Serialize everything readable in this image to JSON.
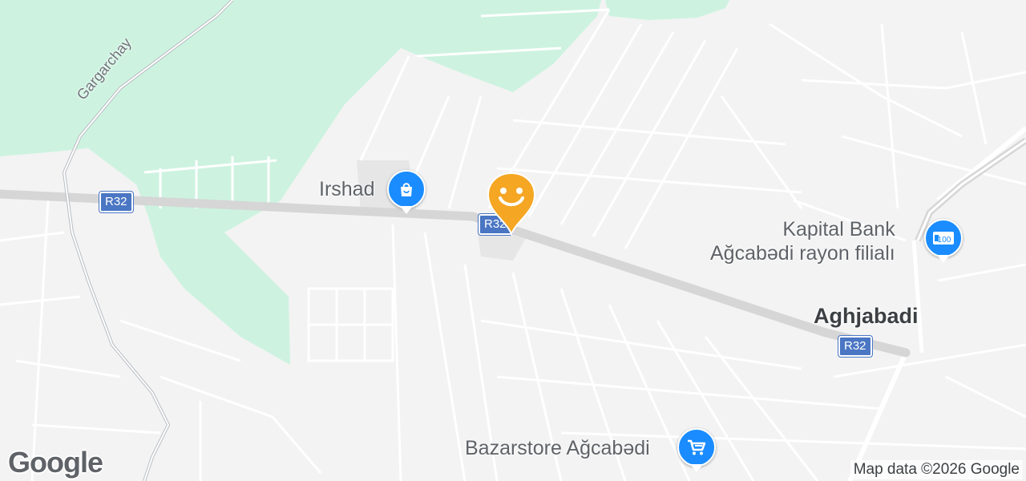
{
  "map": {
    "colors": {
      "land": "#f3f3f3",
      "park": "#cdf3e0",
      "road_main": "#d6d6d6",
      "road_minor": "#ffffff",
      "shield": "#4a76c3",
      "marker": "#f5a623",
      "poi_blue": "#1a8cff"
    },
    "river_label": "Gargarchay",
    "road_shields": [
      "R32",
      "R32",
      "R32"
    ],
    "town_label": "Aghjabadi",
    "pois": {
      "irshad": {
        "label": "Irshad",
        "icon": "shopping-bag-icon"
      },
      "kapital_bank": {
        "line1": "Kapital Bank",
        "line2": "Ağcabədi rayon filialı",
        "icon": "atm-icon"
      },
      "bazarstore": {
        "label": "Bazarstore Ağcabədi",
        "icon": "shopping-cart-icon"
      }
    },
    "marker": {
      "icon": "smiley-icon"
    },
    "logo": "Google",
    "attribution": "Map data ©2026 Google"
  }
}
